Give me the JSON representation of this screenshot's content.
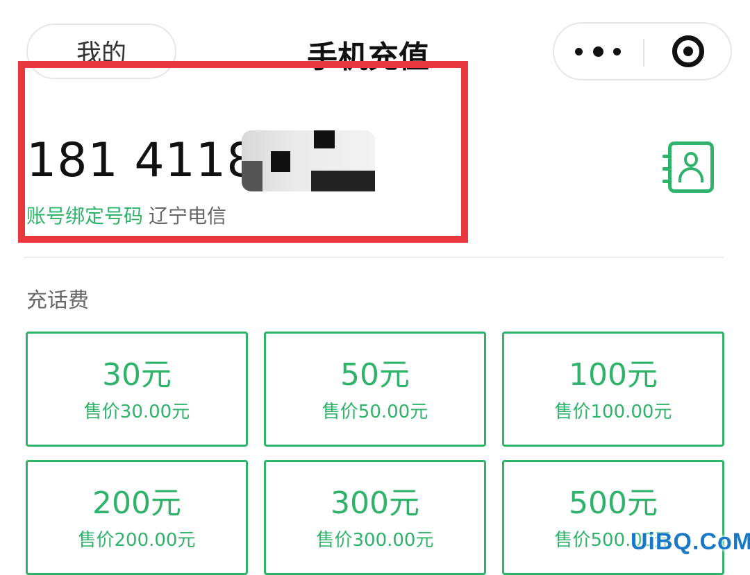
{
  "header": {
    "back_label": "我的",
    "title": "手机充值"
  },
  "account": {
    "phone_visible": "181 4118",
    "bound_label": "账号绑定号码",
    "carrier": "辽宁电信"
  },
  "section": {
    "title": "充话费"
  },
  "options": [
    {
      "amount": "30元",
      "price": "售价30.00元"
    },
    {
      "amount": "50元",
      "price": "售价50.00元"
    },
    {
      "amount": "100元",
      "price": "售价100.00元"
    },
    {
      "amount": "200元",
      "price": "售价200.00元"
    },
    {
      "amount": "300元",
      "price": "售价300.00元"
    },
    {
      "amount": "500元",
      "price": "售价500.00元"
    }
  ],
  "watermark": "UiBQ.CoM",
  "colors": {
    "accent": "#2fb36a",
    "highlight": "#e8383d"
  },
  "icons": {
    "more": "more-dots-icon",
    "close": "target-circle-icon",
    "contacts": "contact-book-icon"
  }
}
